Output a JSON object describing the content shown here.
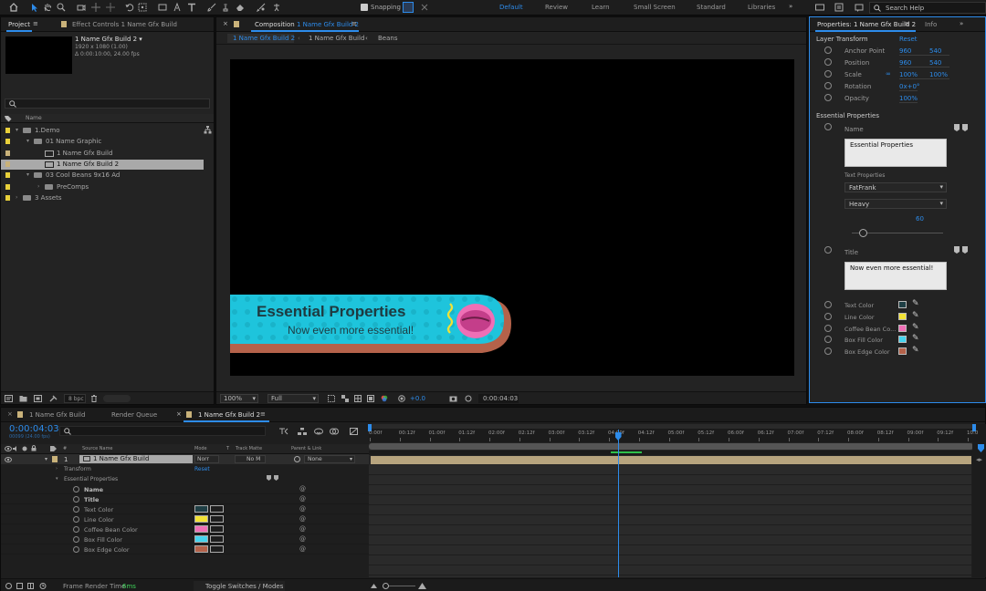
{
  "workspace": {
    "snapping": "Snapping",
    "tabs": [
      "Default",
      "Review",
      "Learn",
      "Small Screen",
      "Standard",
      "Libraries"
    ],
    "active": "Default",
    "search_placeholder": "Search Help"
  },
  "project": {
    "tab_project": "Project",
    "tab_effect": "Effect Controls",
    "tab_effect_target": "1 Name Gfx Build",
    "comp_name": "1 Name Gfx Build 2 ▾",
    "comp_res": "1920 x 1080 (1.00)",
    "comp_dur": "Δ 0:00:10:00, 24.00 fps",
    "col_name": "Name",
    "tree": [
      {
        "label": "1.Demo",
        "depth": 0,
        "type": "folder",
        "open": true,
        "color": "#e8d03a"
      },
      {
        "label": "01 Name Graphic",
        "depth": 1,
        "type": "folder",
        "open": true,
        "color": "#e8d03a"
      },
      {
        "label": "1 Name Gfx Build",
        "depth": 2,
        "type": "comp",
        "color": "#c9b27a"
      },
      {
        "label": "1 Name Gfx Build 2",
        "depth": 2,
        "type": "comp",
        "color": "#c9b27a",
        "selected": true
      },
      {
        "label": "03 Cool Beans 9x16 Ad",
        "depth": 1,
        "type": "folder",
        "open": true,
        "color": "#e8d03a"
      },
      {
        "label": "PreComps",
        "depth": 2,
        "type": "folder",
        "open": false,
        "color": "#e8d03a"
      },
      {
        "label": "3 Assets",
        "depth": 0,
        "type": "folder",
        "open": false,
        "color": "#e8d03a"
      }
    ],
    "bpc": "8 bpc"
  },
  "composition": {
    "tab_label": "Composition",
    "tab_name": "1 Name Gfx Build 2",
    "crumbs": [
      "1 Name Gfx Build 2",
      "1 Name Gfx Build",
      "Beans"
    ],
    "lower_third": {
      "title": "Essential Properties",
      "subtitle": "Now even more essential!",
      "bg_color": "#1ec4dc",
      "edge_color": "#b4624a",
      "line_color": "#f2e235",
      "text_color": "#1e3a40"
    },
    "zoom": "100%",
    "resolution": "Full",
    "exposure": "+0.0",
    "timecode": "0:00:04:03"
  },
  "properties": {
    "tab": "Properties: 1 Name Gfx Build 2",
    "tab_info": "Info",
    "layer_transform": "Layer Transform",
    "reset": "Reset",
    "transform": [
      {
        "label": "Anchor Point",
        "v1": "960",
        "v2": "540"
      },
      {
        "label": "Position",
        "v1": "960",
        "v2": "540"
      },
      {
        "label": "Scale",
        "v1": "100%",
        "v2": "100%"
      },
      {
        "label": "Rotation",
        "v1": "0x+0°"
      },
      {
        "label": "Opacity",
        "v1": "100%"
      }
    ],
    "essential_title": "Essential Properties",
    "name_label": "Name",
    "name_value": "Essential Properties",
    "text_properties": "Text Properties",
    "font": "FatFrank",
    "style": "Heavy",
    "size": "60",
    "size_fraction": 0.08,
    "title_label": "Title",
    "title_value": "Now even more essential!",
    "colors": [
      {
        "label": "Text Color",
        "color": "#1f3f45"
      },
      {
        "label": "Line Color",
        "color": "#f2e235"
      },
      {
        "label": "Coffee Bean Co...",
        "color": "#ef6fb6"
      },
      {
        "label": "Box Fill Color",
        "color": "#46d3ee"
      },
      {
        "label": "Box Edge Color",
        "color": "#b4624a"
      }
    ]
  },
  "timeline": {
    "tabs": [
      "1 Name Gfx Build",
      "Render Queue",
      "1 Name Gfx Build 2"
    ],
    "timecode": "0:00:04:03",
    "frames": "00099 (24.00 fps)",
    "cols": {
      "source": "Source Name",
      "mode": "Mode",
      "t": "T",
      "matte": "Track Matte",
      "parent": "Parent & Link"
    },
    "layer_num": "1",
    "layer_name": "1 Name Gfx Build",
    "layer_mode": "Norr",
    "layer_matte": "No M",
    "layer_parent": "None",
    "transform": "Transform",
    "reset": "Reset",
    "essential": "Essential Properties",
    "props": [
      {
        "label": "Name",
        "bold": true
      },
      {
        "label": "Title",
        "bold": true
      },
      {
        "label": "Text Color",
        "color": "#1f3f45"
      },
      {
        "label": "Line Color",
        "color": "#f2e235"
      },
      {
        "label": "Coffee Bean Color",
        "color": "#ef6fb6"
      },
      {
        "label": "Box Fill Color",
        "color": "#46d3ee"
      },
      {
        "label": "Box Edge Color",
        "color": "#b4624a"
      }
    ],
    "ruler": [
      "0:00f",
      "00:12f",
      "01:00f",
      "01:12f",
      "02:00f",
      "02:12f",
      "03:00f",
      "03:12f",
      "04:00f",
      "04:12f",
      "05:00f",
      "05:12f",
      "06:00f",
      "06:12f",
      "07:00f",
      "07:12f",
      "08:00f",
      "08:12f",
      "09:00f",
      "09:12f",
      "10:0"
    ],
    "playhead_fraction": 0.41,
    "frame_render_label": "Frame Render Time",
    "frame_render_value": "6ms",
    "toggle": "Toggle Switches / Modes"
  }
}
